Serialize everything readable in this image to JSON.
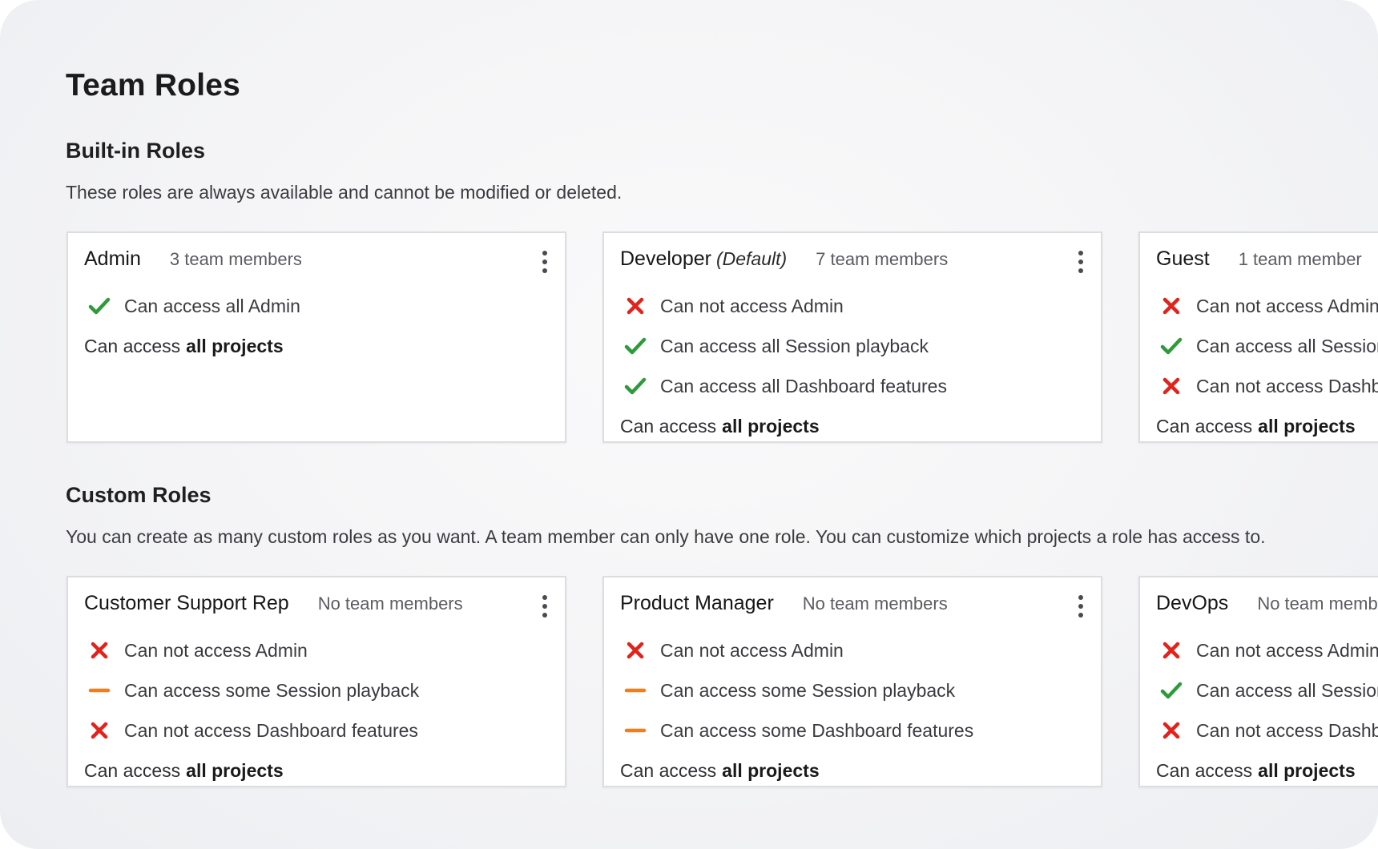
{
  "page": {
    "title": "Team Roles"
  },
  "colors": {
    "allow": "#2e9a3c",
    "deny": "#e0241b",
    "partial": "#f07d1e"
  },
  "builtin": {
    "title": "Built-in Roles",
    "description": "These roles are always available and cannot be modified or deleted.",
    "roles": [
      {
        "name": "Admin",
        "tag": "",
        "members": "3 team members",
        "permissions": [
          {
            "icon": "check-icon",
            "status": "allow",
            "text": "Can access all Admin"
          }
        ],
        "projects_prefix": "Can access",
        "projects_value": "all projects"
      },
      {
        "name": "Developer",
        "tag": "(Default)",
        "members": "7 team members",
        "permissions": [
          {
            "icon": "cross-icon",
            "status": "deny",
            "text": "Can not access Admin"
          },
          {
            "icon": "check-icon",
            "status": "allow",
            "text": "Can access all Session playback"
          },
          {
            "icon": "check-icon",
            "status": "allow",
            "text": "Can access all Dashboard features"
          }
        ],
        "projects_prefix": "Can access",
        "projects_value": "all projects"
      },
      {
        "name": "Guest",
        "tag": "",
        "members": "1 team member",
        "permissions": [
          {
            "icon": "cross-icon",
            "status": "deny",
            "text": "Can not access Admin"
          },
          {
            "icon": "check-icon",
            "status": "allow",
            "text": "Can access all Session playback"
          },
          {
            "icon": "cross-icon",
            "status": "deny",
            "text": "Can not access Dashboard features"
          }
        ],
        "projects_prefix": "Can access",
        "projects_value": "all projects"
      }
    ]
  },
  "custom": {
    "title": "Custom Roles",
    "description": "You can create as many custom roles as you want. A team member can only have one role. You can customize which projects a role has access to.",
    "roles": [
      {
        "name": "Customer Support Rep",
        "tag": "",
        "members": "No team members",
        "permissions": [
          {
            "icon": "cross-icon",
            "status": "deny",
            "text": "Can not access Admin"
          },
          {
            "icon": "dash-icon",
            "status": "partial",
            "text": "Can access some Session playback"
          },
          {
            "icon": "cross-icon",
            "status": "deny",
            "text": "Can not access Dashboard features"
          }
        ],
        "projects_prefix": "Can access",
        "projects_value": "all projects"
      },
      {
        "name": "Product Manager",
        "tag": "",
        "members": "No team members",
        "permissions": [
          {
            "icon": "cross-icon",
            "status": "deny",
            "text": "Can not access Admin"
          },
          {
            "icon": "dash-icon",
            "status": "partial",
            "text": "Can access some Session playback"
          },
          {
            "icon": "dash-icon",
            "status": "partial",
            "text": "Can access some Dashboard features"
          }
        ],
        "projects_prefix": "Can access",
        "projects_value": "all projects"
      },
      {
        "name": "DevOps",
        "tag": "",
        "members": "No team members",
        "permissions": [
          {
            "icon": "cross-icon",
            "status": "deny",
            "text": "Can not access Admin"
          },
          {
            "icon": "check-icon",
            "status": "allow",
            "text": "Can access all Session playback"
          },
          {
            "icon": "cross-icon",
            "status": "deny",
            "text": "Can not access Dashboard features"
          }
        ],
        "projects_prefix": "Can access",
        "projects_value": "all projects"
      }
    ]
  }
}
